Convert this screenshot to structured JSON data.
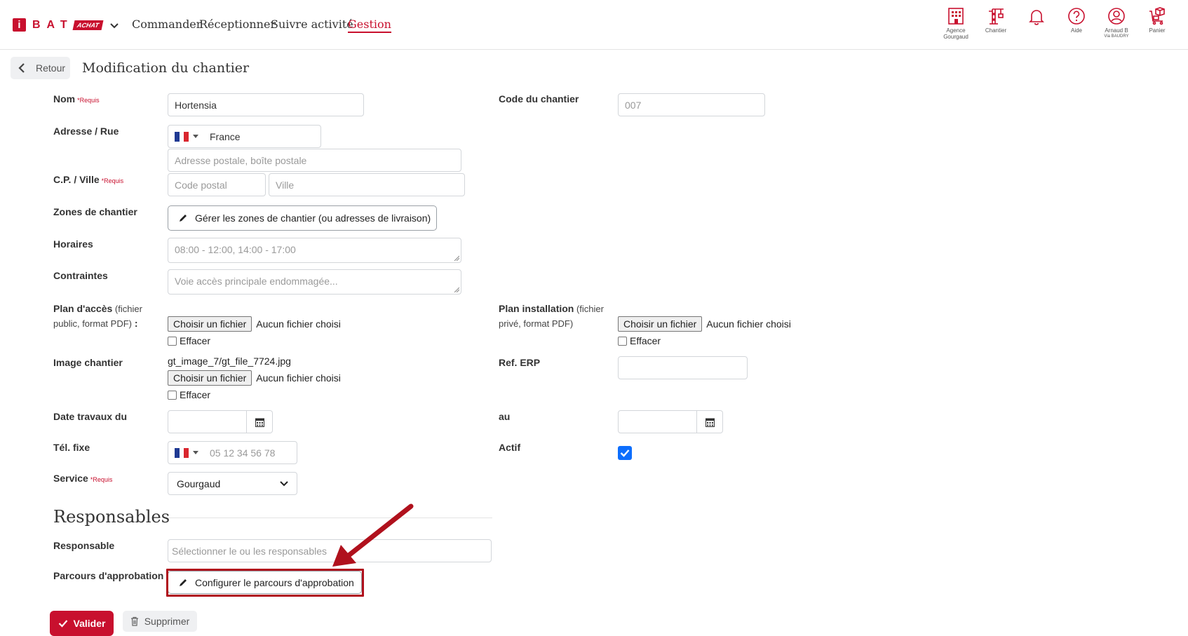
{
  "brand": {
    "letter_i": "i",
    "name": "BAT",
    "badge": "ACHAT"
  },
  "nav": {
    "commander": "Commander",
    "receptionner": "Réceptionner",
    "suivre": "Suivre activité",
    "gestion": "Gestion"
  },
  "toolbar": {
    "agence_1": "Agence",
    "agence_2": "Gourgaud",
    "chantier": "Chantier",
    "aide": "Aide",
    "user_1": "Arnaud B",
    "user_2": "Via BAUDRY",
    "panier": "Panier"
  },
  "page": {
    "back_label": "Retour",
    "title": "Modification du chantier"
  },
  "form": {
    "required_tag": "*Requis",
    "nom": {
      "label": "Nom",
      "value": "Hortensia"
    },
    "code": {
      "label": "Code du chantier",
      "placeholder": "007"
    },
    "adresse": {
      "label": "Adresse / Rue",
      "country": "France",
      "placeholder": "Adresse postale, boîte postale"
    },
    "cp_ville": {
      "label": "C.P. / Ville",
      "cp_placeholder": "Code postal",
      "ville_placeholder": "Ville"
    },
    "zones": {
      "label": "Zones de chantier",
      "button": "Gérer les zones de chantier (ou adresses de livraison)"
    },
    "horaires": {
      "label": "Horaires",
      "placeholder": "08:00 - 12:00, 14:00 - 17:00"
    },
    "contraintes": {
      "label": "Contraintes",
      "placeholder": "Voie accès principale endommagée..."
    },
    "plan_acces": {
      "label": "Plan d'accès",
      "sub_1": " (fichier",
      "sub_2": "public, format PDF)",
      "colon": " :"
    },
    "plan_install": {
      "label": "Plan installation",
      "sub_1": " (fichier",
      "sub_2": "privé, format PDF)"
    },
    "file_button": "Choisir un fichier",
    "file_none": "Aucun fichier choisi",
    "effacer": "Effacer",
    "image": {
      "label": "Image chantier",
      "current": "gt_image_7/gt_file_7724.jpg"
    },
    "ref_erp": {
      "label": "Ref. ERP"
    },
    "date": {
      "label": "Date travaux du",
      "label_to": "au"
    },
    "tel": {
      "label": "Tél. fixe",
      "placeholder": "05 12 34 56 78"
    },
    "actif": {
      "label": "Actif",
      "checked": true
    },
    "service": {
      "label": "Service",
      "value": "Gourgaud"
    }
  },
  "responsables": {
    "title": "Responsables",
    "responsable_label": "Responsable",
    "responsable_placeholder": "Sélectionner le ou les responsables",
    "parcours_label": "Parcours d'approbation",
    "parcours_button": "Configurer le parcours d'approbation"
  },
  "actions": {
    "valider": "Valider",
    "supprimer": "Supprimer"
  },
  "colors": {
    "brand": "#c8102e",
    "check": "#0d6efd",
    "highlight": "#b0111d"
  }
}
